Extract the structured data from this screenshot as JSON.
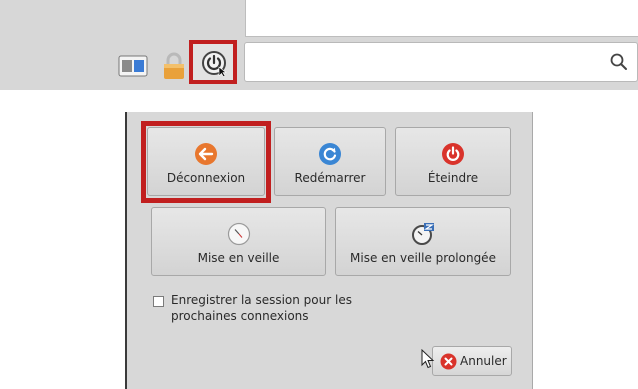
{
  "taskbar": {
    "search": {
      "value": "",
      "placeholder": ""
    }
  },
  "dialog": {
    "buttons": {
      "logout": "Déconnexion",
      "restart": "Redémarrer",
      "shutdown": "Éteindre",
      "sleep": "Mise en veille",
      "hibernate": "Mise en veille prolongée"
    },
    "save_session_label": "Enregistrer la session pour les prochaines connexions",
    "save_session_checked": false,
    "cancel_label": "Annuler"
  },
  "icons": {
    "windows": "windows-switcher-icon",
    "lock": "lock-icon",
    "power": "power-icon",
    "search": "search-icon",
    "logout": "logout-arrow-icon",
    "restart": "restart-icon",
    "shutdown": "shutdown-icon",
    "sleep": "clock-icon",
    "hibernate": "hibernate-icon",
    "cancel": "cancel-icon",
    "cursor": "mouse-cursor-icon"
  },
  "colors": {
    "highlight": "#c11f1f",
    "logout_icon": "#e8772e",
    "restart_icon": "#3a86d4",
    "shutdown_icon": "#d9332b",
    "cancel_icon": "#d9332b"
  }
}
